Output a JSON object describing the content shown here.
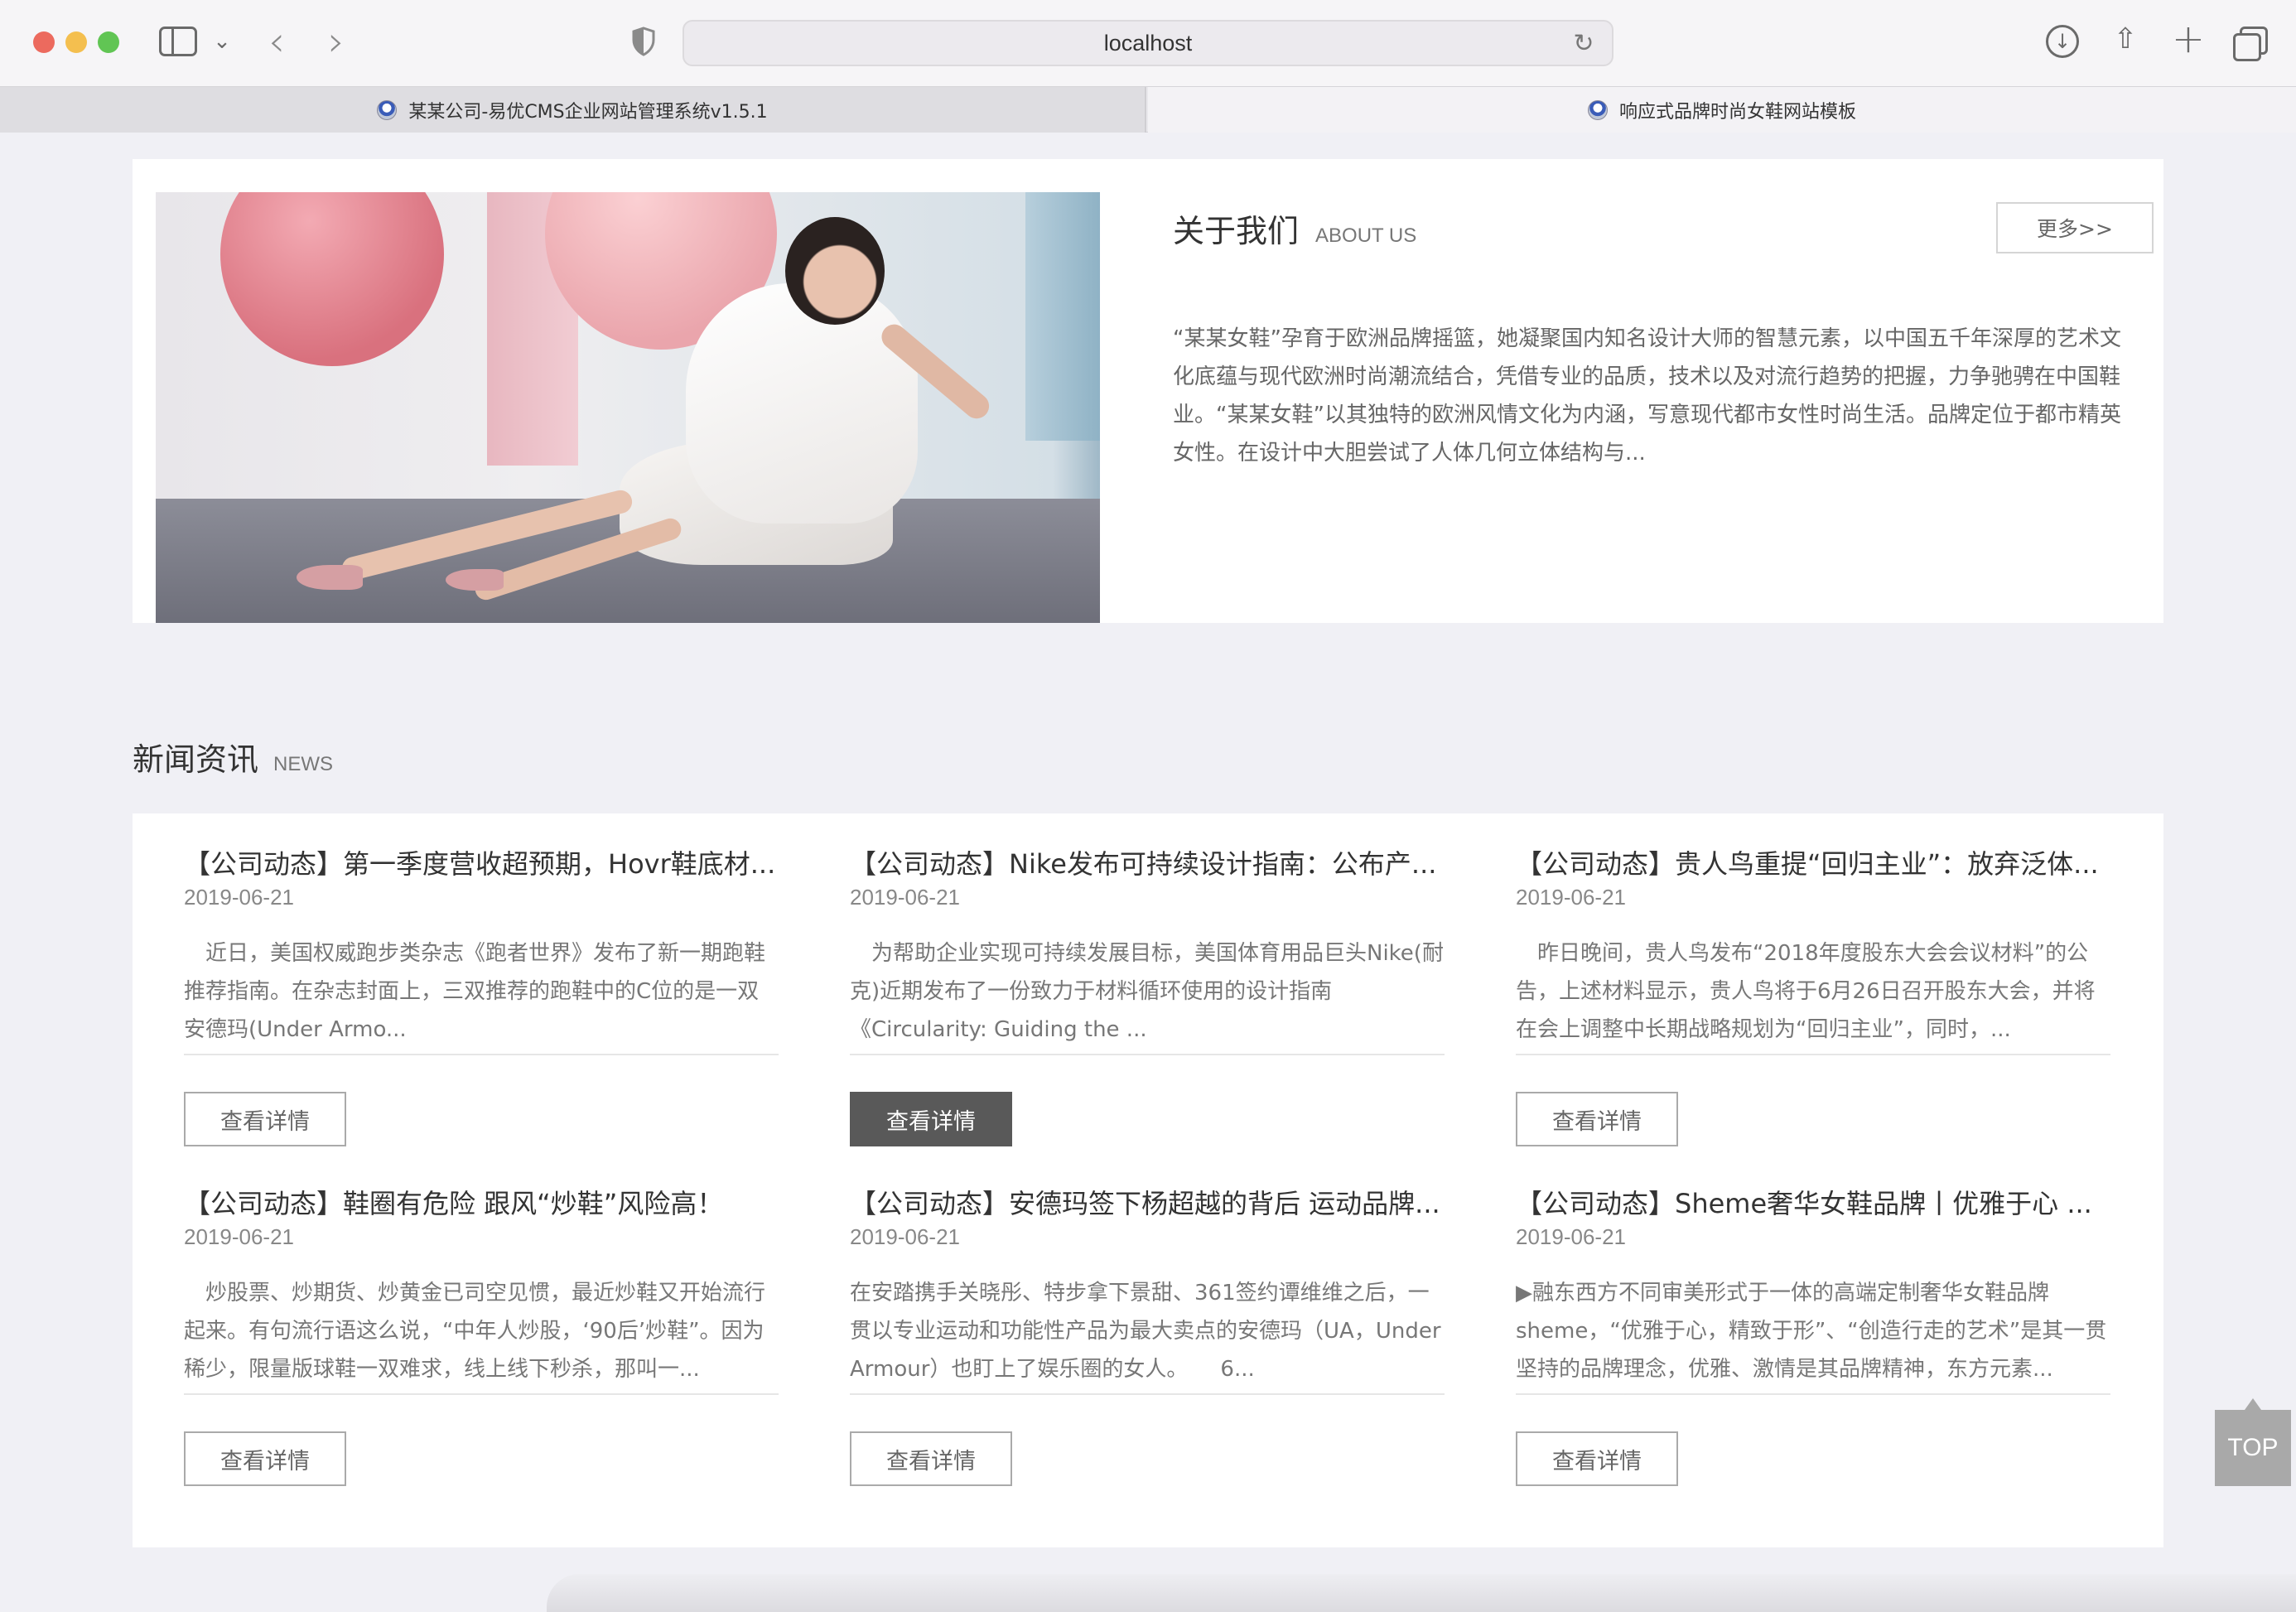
{
  "browser": {
    "address": "localhost",
    "tabs": [
      {
        "label": "某某公司-易优CMS企业网站管理系统v1.5.1"
      },
      {
        "label": "响应式品牌时尚女鞋网站模板"
      }
    ]
  },
  "about": {
    "title_cn": "关于我们",
    "title_en": "ABOUT US",
    "more_label": "更多>>",
    "text": "“某某女鞋”孕育于欧洲品牌摇篮，她凝聚国内知名设计大师的智慧元素，以中国五千年深厚的艺术文化底蕴与现代欧洲时尚潮流结合，凭借专业的品质，技术以及对流行趋势的把握，力争驰骋在中国鞋业。“某某女鞋”以其独特的欧洲风情文化为内涵，写意现代都市女性时尚生活。品牌定位于都市精英女性。在设计中大胆尝试了人体几何立体结构与..."
  },
  "news": {
    "title_cn": "新闻资讯",
    "title_en": "NEWS",
    "items": [
      {
        "title": "【公司动态】第一季度营收超预期，Hovr鞋底材...",
        "date": "2019-06-21",
        "desc": "　近日，美国权威跑步类杂志《跑者世界》发布了新一期跑鞋推荐指南。在杂志封面上，三双推荐的跑鞋中的C位的是一双安德玛(Under Armo...",
        "button": "查看详情"
      },
      {
        "title": "【公司动态】Nike发布可持续设计指南：公布产...",
        "date": "2019-06-21",
        "desc": "　为帮助企业实现可持续发展目标，美国体育用品巨头Nike(耐克)近期发布了一份致力于材料循环使用的设计指南《Circularity: Guiding the ...",
        "button": "查看详情"
      },
      {
        "title": "【公司动态】贵人鸟重提“回归主业”：放弃泛体...",
        "date": "2019-06-21",
        "desc": "　昨日晚间，贵人鸟发布“2018年度股东大会会议材料”的公告，上述材料显示，贵人鸟将于6月26日召开股东大会，并将在会上调整中长期战略规划为“回归主业”，同时，...",
        "button": "查看详情"
      },
      {
        "title": "【公司动态】鞋圈有危险 跟风“炒鞋”风险高！",
        "date": "2019-06-21",
        "desc": "　炒股票、炒期货、炒黄金已司空见惯，最近炒鞋又开始流行起来。有句流行语这么说，“中年人炒股，‘90后’炒鞋”。因为稀少，限量版球鞋一双难求，线上线下秒杀，那叫一...",
        "button": "查看详情"
      },
      {
        "title": "【公司动态】安德玛签下杨超越的背后 运动品牌...",
        "date": "2019-06-21",
        "desc": "在安踏携手关晓彤、特步拿下景甜、361签约谭维维之后，一贯以专业运动和功能性产品为最大卖点的安德玛（UA，Under Armour）也盯上了娱乐圈的女人。　　6...",
        "button": "查看详情"
      },
      {
        "title": "【公司动态】Sheme奢华女鞋品牌丨优雅于心 ...",
        "date": "2019-06-21",
        "desc": "▶融东西方不同审美形式于一体的高端定制奢华女鞋品牌sheme，“优雅于心，精致于形”、“创造行走的艺术”是其一贯坚持的品牌理念，优雅、激情是其品牌精神，东方元素...",
        "button": "查看详情"
      }
    ]
  },
  "top_button": "TOP"
}
